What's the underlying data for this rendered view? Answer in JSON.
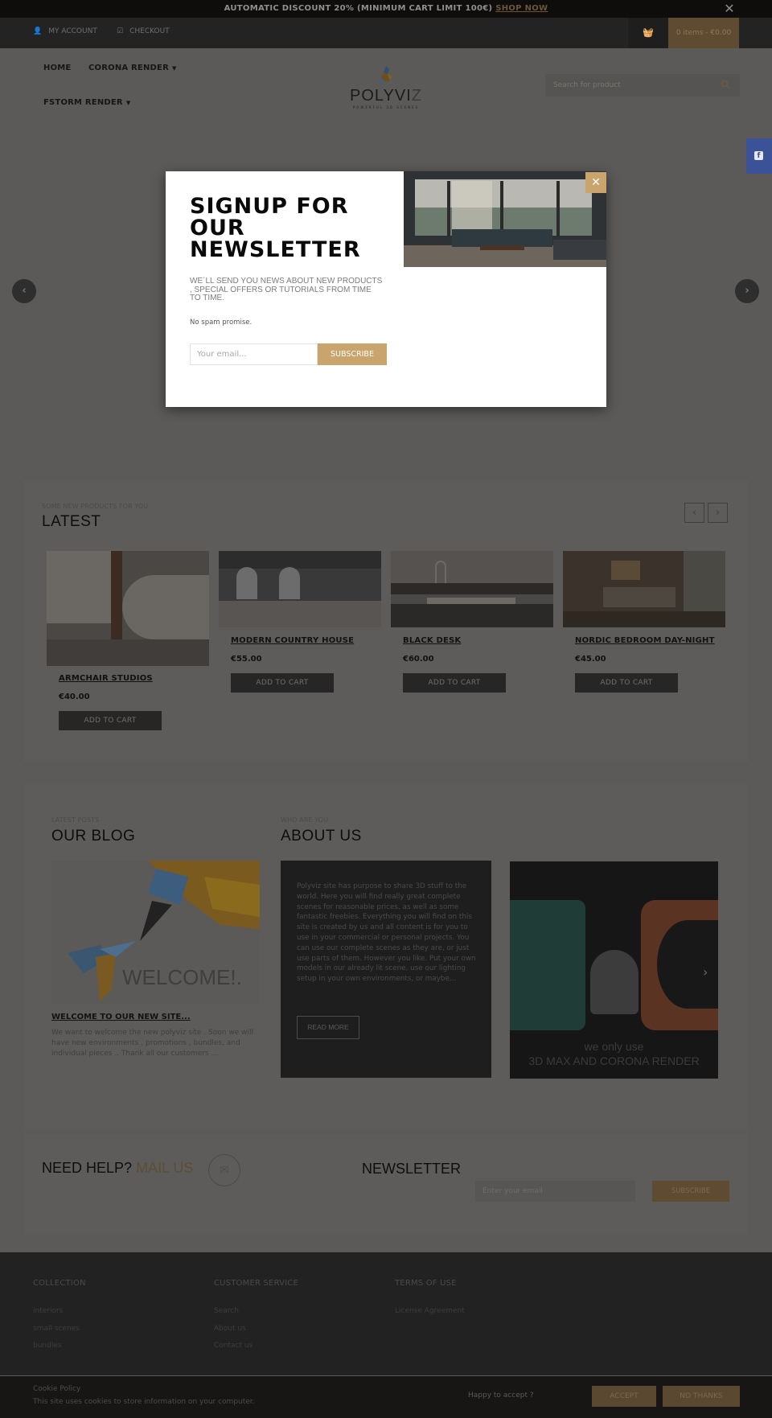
{
  "promo": {
    "text": "AUTOMATIC DISCOUNT 20% (MINIMUM CART LIMIT 100€)",
    "link": "SHOP NOW",
    "close": "✕"
  },
  "account_bar": {
    "my_account": "MY ACCOUNT",
    "checkout": "CHECKOUT",
    "cart": "0 items - €0.00"
  },
  "nav": {
    "items": [
      {
        "label": "HOME"
      },
      {
        "label": "CORONA RENDER",
        "has_dropdown": true
      },
      {
        "label": "FSTORM RENDER",
        "has_dropdown": true
      }
    ],
    "caret": "▼"
  },
  "logo": {
    "name_a": "POLYVI",
    "name_b": "Z",
    "tagline": "POWERFUL 3D SCENES"
  },
  "search": {
    "placeholder": "Search for product",
    "icon": "🔍"
  },
  "social": {
    "facebook": "f"
  },
  "slider": {
    "prev": "‹",
    "next": "›"
  },
  "latest": {
    "kicker": "SOME NEW PRODUCTS FOR YOU",
    "title": "LATEST",
    "prev": "‹",
    "next": "›",
    "add_to_cart": "ADD TO CART",
    "products": [
      {
        "name": "ARMCHAIR STUDIOS",
        "price": "€40.00"
      },
      {
        "name": "MODERN COUNTRY HOUSE",
        "price": "€55.00"
      },
      {
        "name": "BLACK DESK",
        "price": "€60.00"
      },
      {
        "name": "NORDIC BEDROOM DAY-NIGHT",
        "price": "€45.00"
      }
    ]
  },
  "blog": {
    "kicker": "LATEST POSTS",
    "title": "OUR BLOG",
    "image_text": "WELCOME!.",
    "post_title": "WELCOME TO OUR NEW SITE...",
    "post_excerpt": "We want to welcome the new polyviz site . Soon we will have new environments , promotions , bundles, and individual pieces .. Thank all our customers ..."
  },
  "about": {
    "kicker": "WHO ARE YOU",
    "title": "ABOUT US",
    "body": "Polyviz site has purpose to share 3D stuff to the world. Here you will find really great complete scenes for reasonable prices, as well as some fantastic freebies. Everything you will find on this site is created by us and all content is for you to use in your commercial or personal projects. You can use our complete scenes as they are, or just use parts of them. However you like. Put your own models in our already lit scene, use our lighting setup in your own environments, or maybe...",
    "read_more": "READ MORE",
    "image_line1": "we only use",
    "image_line2": "3D MAX AND CORONA RENDER",
    "image_next": "›"
  },
  "help": {
    "need_help": "NEED HELP?",
    "mail_us": "MAIL US",
    "mail_icon": "✉"
  },
  "newsletter_footer": {
    "title": "NEWSLETTER",
    "placeholder": "Enter your email",
    "button": "SUBSCRIBE"
  },
  "footer": {
    "columns": [
      {
        "heading": "COLLECTION",
        "links": [
          "interiors",
          "small scenes",
          "bundles"
        ]
      },
      {
        "heading": "CUSTOMER SERVICE",
        "links": [
          "Search",
          "About us",
          "Contact us"
        ]
      },
      {
        "heading": "TERMS OF USE",
        "links": [
          "License Agreement"
        ]
      }
    ]
  },
  "cookie": {
    "title": "Cookie Policy",
    "text": "This site uses cookies to store information on your computer.",
    "question": "Happy to accept ?",
    "accept": "ACCEPT",
    "decline": "NO THANKS"
  },
  "modal": {
    "title": "SIGNUP FOR OUR NEWSLETTER",
    "subtitle": "WE´LL SEND YOU NEWS ABOUT NEW PRODUCTS , SPECIAL OFFERS OR TUTORIALS FROM TIME TO TIME.",
    "spam": "No spam promise.",
    "email_placeholder": "Your email...",
    "subscribe": "SUBSCRIBE",
    "close": "✕"
  },
  "colors": {
    "accent_gold": "#c9a46d",
    "facebook_blue": "#3b5298",
    "overlay": "#5b5a58"
  }
}
